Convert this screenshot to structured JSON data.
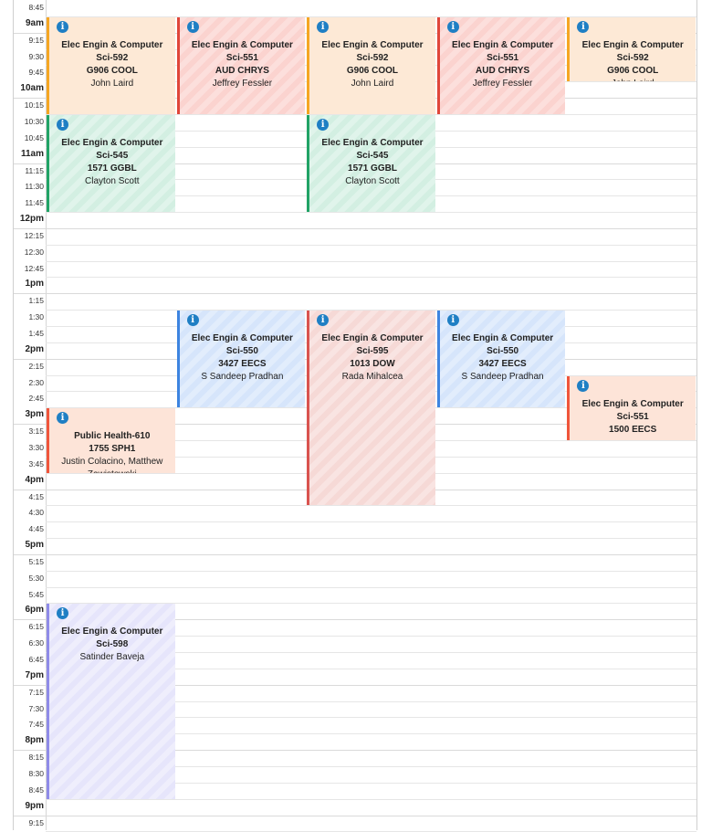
{
  "time_labels": [
    "8:45",
    "9am",
    "9:15",
    "9:30",
    "9:45",
    "10am",
    "10:15",
    "10:30",
    "10:45",
    "11am",
    "11:15",
    "11:30",
    "11:45",
    "12pm",
    "12:15",
    "12:30",
    "12:45",
    "1pm",
    "1:15",
    "1:30",
    "1:45",
    "2pm",
    "2:15",
    "2:30",
    "2:45",
    "3pm",
    "3:15",
    "3:30",
    "3:45",
    "4pm",
    "4:15",
    "4:30",
    "4:45",
    "5pm",
    "5:15",
    "5:30",
    "5:45",
    "6pm",
    "6:15",
    "6:30",
    "6:45",
    "7pm",
    "7:15",
    "7:30",
    "7:45",
    "8pm",
    "8:15",
    "8:30",
    "8:45",
    "9pm",
    "9:15"
  ],
  "events": [
    {
      "day": 0,
      "start": "9:00",
      "end": "10:30",
      "color": "orange",
      "title": "Elec Engin & Computer Sci-592",
      "location": "G906 COOL",
      "instructor": "John Laird",
      "icon": "info-icon"
    },
    {
      "day": 1,
      "start": "9:00",
      "end": "10:30",
      "color": "red",
      "title": "Elec Engin & Computer Sci-551",
      "location": "AUD CHRYS",
      "instructor": "Jeffrey Fessler",
      "icon": "info-icon"
    },
    {
      "day": 2,
      "start": "9:00",
      "end": "10:30",
      "color": "orange",
      "title": "Elec Engin & Computer Sci-592",
      "location": "G906 COOL",
      "instructor": "John Laird",
      "icon": "info-icon"
    },
    {
      "day": 3,
      "start": "9:00",
      "end": "10:30",
      "color": "red",
      "title": "Elec Engin & Computer Sci-551",
      "location": "AUD CHRYS",
      "instructor": "Jeffrey Fessler",
      "icon": "info-icon"
    },
    {
      "day": 4,
      "start": "9:00",
      "end": "10:00",
      "color": "orange",
      "title": "Elec Engin & Computer Sci-592",
      "location": "G906 COOL",
      "instructor": "John Laird",
      "icon": "info-icon"
    },
    {
      "day": 0,
      "start": "10:30",
      "end": "12:00",
      "color": "green",
      "title": "Elec Engin & Computer Sci-545",
      "location": "1571 GGBL",
      "instructor": "Clayton Scott",
      "icon": "info-icon"
    },
    {
      "day": 2,
      "start": "10:30",
      "end": "12:00",
      "color": "green",
      "title": "Elec Engin & Computer Sci-545",
      "location": "1571 GGBL",
      "instructor": "Clayton Scott",
      "icon": "info-icon"
    },
    {
      "day": 1,
      "start": "13:30",
      "end": "15:00",
      "color": "blue",
      "title": "Elec Engin & Computer Sci-550",
      "location": "3427 EECS",
      "instructor": "S Sandeep Pradhan",
      "icon": "info-icon"
    },
    {
      "day": 2,
      "start": "13:30",
      "end": "16:30",
      "color": "darkred",
      "title": "Elec Engin & Computer Sci-595",
      "location": "1013 DOW",
      "instructor": "Rada Mihalcea",
      "icon": "info-icon"
    },
    {
      "day": 3,
      "start": "13:30",
      "end": "15:00",
      "color": "blue",
      "title": "Elec Engin & Computer Sci-550",
      "location": "3427 EECS",
      "instructor": "S Sandeep Pradhan",
      "icon": "info-icon"
    },
    {
      "day": 4,
      "start": "14:30",
      "end": "15:30",
      "color": "peach",
      "title": "Elec Engin & Computer Sci-551",
      "location": "1500 EECS",
      "instructor": "",
      "icon": "info-icon"
    },
    {
      "day": 0,
      "start": "15:00",
      "end": "16:00",
      "color": "peach",
      "title": "Public Health-610",
      "location": "1755 SPH1",
      "instructor": "Justin Colacino, Matthew Zawistowski",
      "icon": "info-icon"
    },
    {
      "day": 0,
      "start": "18:00",
      "end": "21:00",
      "color": "purple",
      "title": "Elec Engin & Computer Sci-598",
      "location": "",
      "instructor": "Satinder Baveja",
      "icon": "info-icon"
    }
  ]
}
